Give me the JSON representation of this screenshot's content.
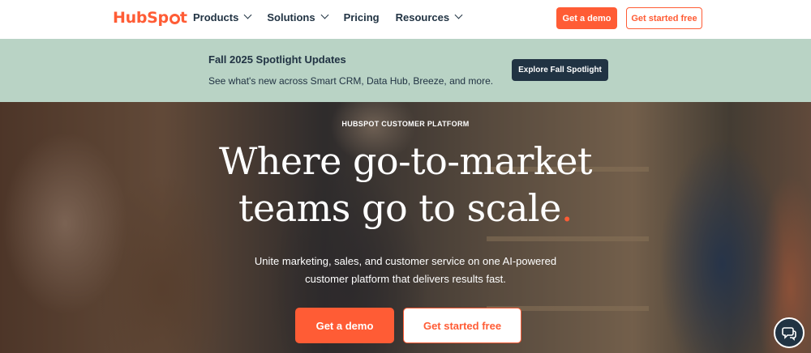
{
  "nav": {
    "logo": {
      "text_before": "Hub",
      "text_after": "t",
      "mid": "Sp"
    },
    "menu": [
      {
        "label": "Products",
        "has_dropdown": true
      },
      {
        "label": "Solutions",
        "has_dropdown": true
      },
      {
        "label": "Pricing",
        "has_dropdown": false
      },
      {
        "label": "Resources",
        "has_dropdown": true
      }
    ],
    "demo_label": "Get a demo",
    "free_label": "Get started free"
  },
  "banner": {
    "title": "Fall 2025 Spotlight Updates",
    "subtitle": "See what's new across Smart CRM, Data Hub, Breeze, and more.",
    "button_label": "Explore Fall Spotlight"
  },
  "hero": {
    "kicker": "HUBSPOT CUSTOMER PLATFORM",
    "title_line1": "Where go-to-market",
    "title_line2": "teams go to scale",
    "title_dot": ".",
    "subtitle_line1": "Unite marketing, sales, and customer service on one AI-powered",
    "subtitle_line2": "customer platform that delivers results fast.",
    "demo_label": "Get a demo",
    "free_label": "Get started free"
  },
  "colors": {
    "brand": "#ff5c35",
    "ink": "#213343",
    "banner_bg": "#b9d3c5"
  },
  "icons": {
    "chevron": "chevron-down-icon",
    "chat": "chat-icon"
  }
}
